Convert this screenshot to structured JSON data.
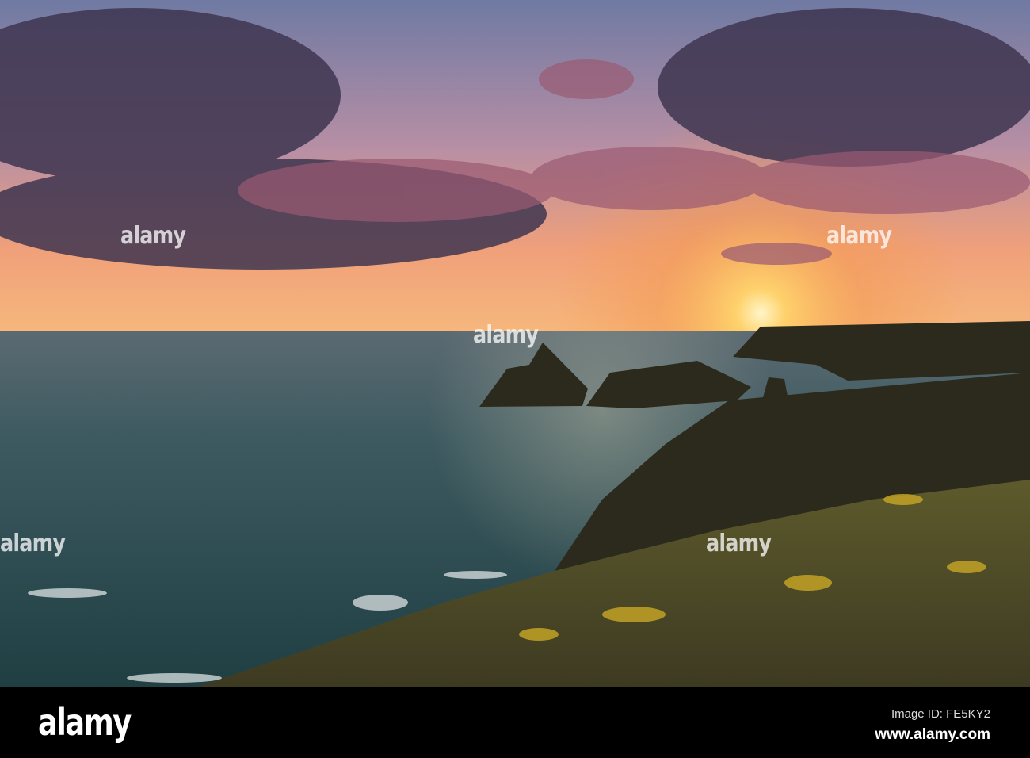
{
  "watermark": {
    "text": "alamy"
  },
  "footer": {
    "logo": "alamy",
    "image_id": "Image ID: FE5KY2",
    "website": "www.alamy.com"
  },
  "colors": {
    "sky_top": "#5b6a93",
    "sun": "#ffd36b",
    "sea": "#2f4e55",
    "grass": "#4d5028"
  }
}
